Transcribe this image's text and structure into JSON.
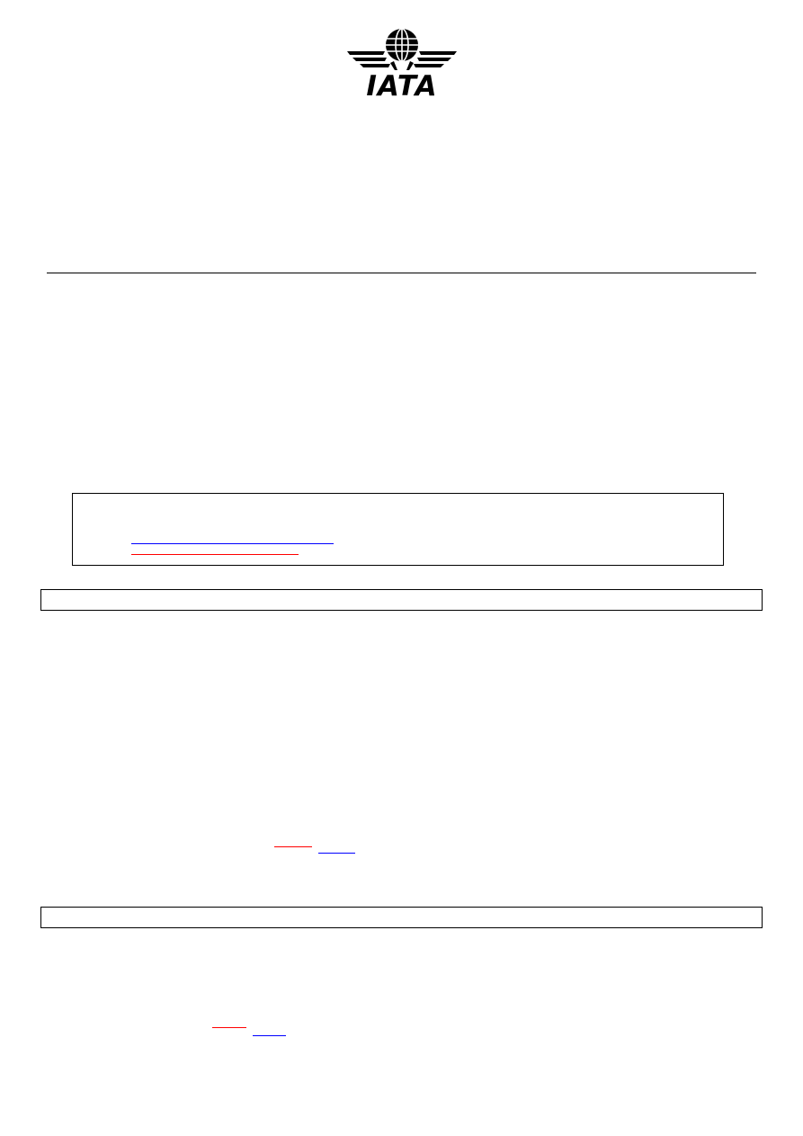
{
  "logo": {
    "text": "IATA",
    "icon": "iata-globe-wings-logo",
    "color": "#000000"
  },
  "contact_box": {
    "links": [
      {
        "text": "",
        "color": "#0000ff"
      },
      {
        "text": "",
        "color": "#ff0000"
      }
    ]
  },
  "sections": [
    {
      "title": "",
      "links": [
        {
          "text": "",
          "color": "#ff0000"
        },
        {
          "text": "",
          "color": "#0000ff"
        }
      ]
    },
    {
      "title": "",
      "links": [
        {
          "text": "",
          "color": "#ff0000"
        },
        {
          "text": "",
          "color": "#0000ff"
        }
      ]
    }
  ]
}
